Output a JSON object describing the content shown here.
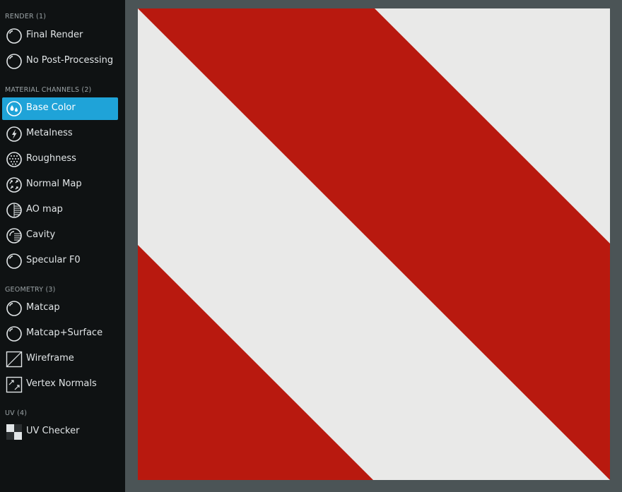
{
  "sidebar": {
    "sections": [
      {
        "title": "RENDER (1)"
      },
      {
        "title": "MATERIAL CHANNELS (2)"
      },
      {
        "title": "GEOMETRY (3)"
      },
      {
        "title": "UV (4)"
      }
    ],
    "items": [
      {
        "label": "Final Render",
        "icon": "sphere-icon"
      },
      {
        "label": "No Post-Processing",
        "icon": "sphere-icon"
      },
      {
        "label": "Base Color",
        "icon": "droplets-icon",
        "active": true
      },
      {
        "label": "Metalness",
        "icon": "lightning-icon"
      },
      {
        "label": "Roughness",
        "icon": "dotted-sphere-icon"
      },
      {
        "label": "Normal Map",
        "icon": "arrows-sphere-icon"
      },
      {
        "label": "AO map",
        "icon": "half-shaded-sphere-icon"
      },
      {
        "label": "Cavity",
        "icon": "lined-sphere-icon"
      },
      {
        "label": "Specular F0",
        "icon": "sphere-icon"
      },
      {
        "label": "Matcap",
        "icon": "sphere-icon"
      },
      {
        "label": "Matcap+Surface",
        "icon": "sphere-icon"
      },
      {
        "label": "Wireframe",
        "icon": "wireframe-icon"
      },
      {
        "label": "Vertex Normals",
        "icon": "vertex-normals-icon"
      },
      {
        "label": "UV Checker",
        "icon": "checker-icon"
      }
    ]
  },
  "colors": {
    "accent": "#1fa3d8",
    "sidebar_bg": "#0f1213",
    "viewport_bg": "#4b5456",
    "stripe_red": "#b8190f",
    "stripe_white": "#e9e9e8"
  }
}
